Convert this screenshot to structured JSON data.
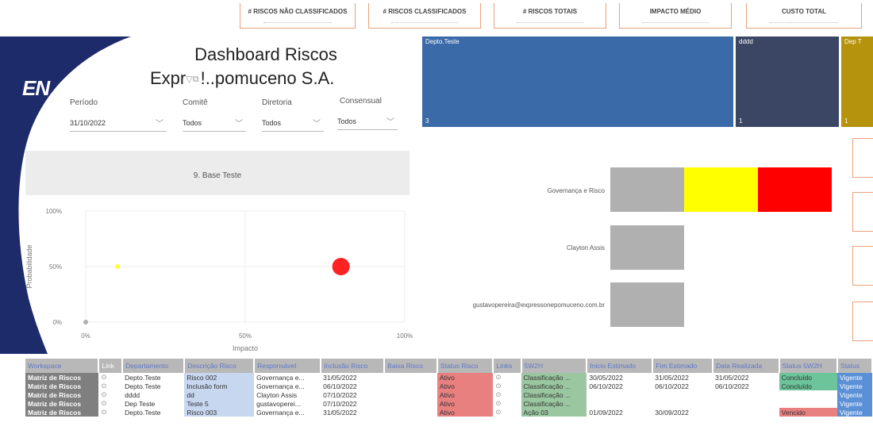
{
  "kpis": [
    {
      "label": "# RISCOS NÃO CLASSIFICADOS"
    },
    {
      "label": "# RISCOS CLASSIFICADOS"
    },
    {
      "label": "# RISCOS TOTAIS"
    },
    {
      "label": "IMPACTO MÉDIO"
    },
    {
      "label": "CUSTO TOTAL"
    }
  ],
  "brand": {
    "logo": "EN",
    "title_line1": "Dashboard Riscos",
    "title_line2": "Expr",
    "title_line2b": "!..pomuceno S.A.",
    "navy": "#1d2b6b"
  },
  "slicers": [
    {
      "label": "Período",
      "value": "31/10/2022"
    },
    {
      "label": "Comitê",
      "value": "Todos"
    },
    {
      "label": "Diretoria",
      "value": "Todos"
    },
    {
      "label": "Consensual",
      "value": "Todos"
    }
  ],
  "section_title": "9. Base Teste",
  "treemap": [
    {
      "label": "Depto.Teste",
      "value": "3",
      "color": "#3a6aa8"
    },
    {
      "label": "dddd",
      "value": "1",
      "color": "#3a4663"
    },
    {
      "label": "Dep T",
      "value": "1",
      "color": "#b5930c"
    }
  ],
  "chart_data": {
    "type": "scatter",
    "xlabel": "Impacto",
    "ylabel": "Probabilidade",
    "x_ticks": [
      "0%",
      "50%",
      "100%"
    ],
    "y_ticks": [
      "0%",
      "50%",
      "100%"
    ],
    "xlim": [
      0,
      100
    ],
    "ylim": [
      0,
      100
    ],
    "points": [
      {
        "x": 0,
        "y": 0,
        "size": 3,
        "color": "#b0b0b0"
      },
      {
        "x": 10,
        "y": 50,
        "size": 3,
        "color": "#ffff33"
      },
      {
        "x": 80,
        "y": 50,
        "size": 11,
        "color": "#ff2222"
      }
    ]
  },
  "responsible_bars": [
    {
      "name": "Governança e Risco",
      "segments": [
        {
          "color": "#b0b0b0"
        },
        {
          "color": "#ffff00"
        },
        {
          "color": "#ff0000"
        }
      ]
    },
    {
      "name": "Clayton Assis",
      "segments": [
        {
          "color": "#b0b0b0"
        }
      ]
    },
    {
      "name": "gustavopereira@expressonepomuceno.com.br",
      "segments": [
        {
          "color": "#b0b0b0"
        }
      ]
    }
  ],
  "table": {
    "headers": [
      "Workspace",
      "Link",
      "Departamento",
      "Descrição Risco",
      "Responsável",
      "Inclusão Risco",
      "Baixa Risco",
      "Status Risco",
      "Links",
      "5W2H",
      "Inicio Estimado",
      "Fim Estimado",
      "Data Realizada",
      "Status 5W2H",
      "Status"
    ],
    "rows": [
      [
        "Matriz de Riscos",
        "Depto.Teste",
        "Risco 002",
        "Governança e...",
        "31/05/2022",
        "",
        "Ativo",
        "Classificação ...",
        "30/05/2022",
        "31/05/2022",
        "31/05/2022",
        "Concluído",
        "Vigente"
      ],
      [
        "Matriz de Riscos",
        "Depto.Teste",
        "Inclusão form",
        "Governança e...",
        "06/10/2022",
        "",
        "Ativo",
        "Classificação ...",
        "06/10/2022",
        "06/10/2022",
        "06/10/2022",
        "Concluído",
        "Vigente"
      ],
      [
        "Matriz de Riscos",
        "dddd",
        "dd",
        "Clayton Assis",
        "07/10/2022",
        "",
        "Ativo",
        "Classificação ...",
        "",
        "",
        "",
        "",
        "Vigente"
      ],
      [
        "Matriz de Riscos",
        "Dep Teste",
        "Teste 5",
        "gustavoperei...",
        "07/10/2022",
        "",
        "Ativo",
        "Classificação ...",
        "",
        "",
        "",
        "",
        "Vigente"
      ],
      [
        "Matriz de Riscos",
        "Depto.Teste",
        "Risco 003",
        "Governança e...",
        "31/05/2022",
        "",
        "Ativo",
        "Ação 03",
        "01/09/2022",
        "30/09/2022",
        "",
        "Vencido",
        "Vigente"
      ]
    ]
  }
}
